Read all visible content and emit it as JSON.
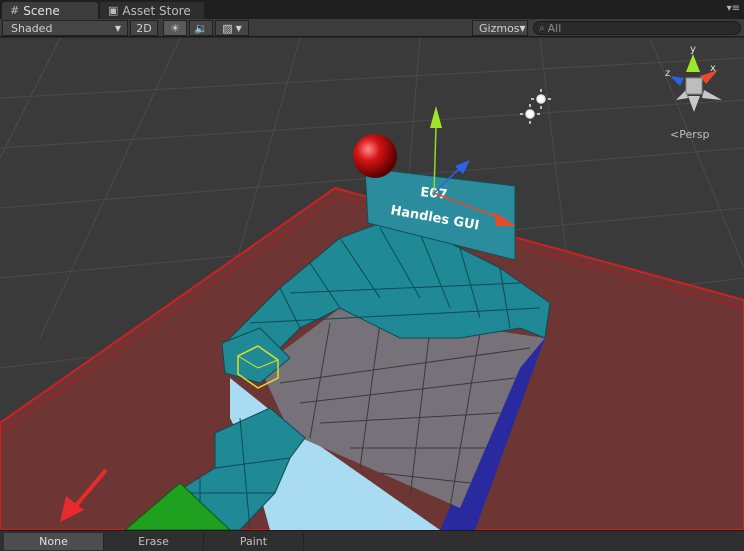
{
  "tabs": [
    {
      "label": "Scene",
      "icon": "grid-icon",
      "active": true
    },
    {
      "label": "Asset Store",
      "icon": "shopping-bag-icon",
      "active": false
    }
  ],
  "toolbar": {
    "shading_mode": "Shaded",
    "btn_2d": "2D",
    "lighting_icon": "sun-icon",
    "audio_icon": "speaker-icon",
    "effects_icon": "image-icon",
    "gizmos_label": "Gizmos",
    "search_placeholder": "All"
  },
  "viewport": {
    "projection_label": "Persp",
    "axis_labels": {
      "x": "x",
      "y": "y",
      "z": "z"
    },
    "sign_lines": [
      "E07",
      "Handles GUI"
    ],
    "colors": {
      "ground_plane": "#7a3a3a",
      "ground_border": "#cc2222",
      "voxel_teal": "#1f8a96",
      "voxel_gray": "#7a7478",
      "voxel_light_blue": "#a9dcf2",
      "voxel_blue": "#2a2aa0",
      "voxel_green": "#1fa01f",
      "sphere_red": "#cc1111",
      "handle_y": "#8fdc2a",
      "handle_x": "#e84a2a",
      "handle_z": "#2a62e8",
      "selection": "#e0e020"
    }
  },
  "bottom_bar": {
    "buttons": [
      {
        "label": "None",
        "selected": true
      },
      {
        "label": "Erase",
        "selected": false
      },
      {
        "label": "Paint",
        "selected": false
      }
    ]
  }
}
